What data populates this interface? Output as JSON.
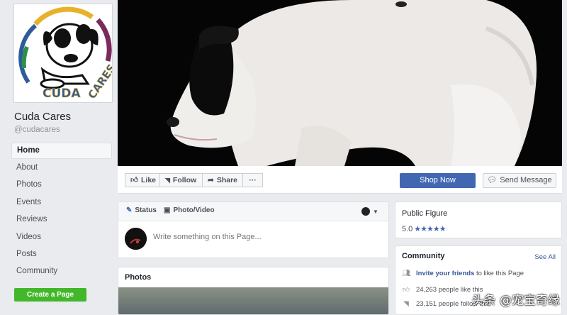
{
  "page": {
    "name": "Cuda Cares",
    "handle": "@cudacares",
    "logo_text": "CUDA CARES"
  },
  "nav": {
    "items": [
      {
        "label": "Home",
        "active": true
      },
      {
        "label": "About"
      },
      {
        "label": "Photos"
      },
      {
        "label": "Events"
      },
      {
        "label": "Reviews"
      },
      {
        "label": "Videos"
      },
      {
        "label": "Posts"
      },
      {
        "label": "Community"
      }
    ],
    "create_page": "Create a Page"
  },
  "actions": {
    "like": "Like",
    "follow": "Follow",
    "share": "Share",
    "more": "···",
    "shop_now": "Shop Now",
    "send_message": "Send Message"
  },
  "composer": {
    "status": "Status",
    "photo_video": "Photo/Video",
    "placeholder": "Write something on this Page..."
  },
  "photos": {
    "title": "Photos"
  },
  "sidebar": {
    "category": "Public Figure",
    "rating": "5.0",
    "stars": 5,
    "community_title": "Community",
    "see_all": "See All",
    "invite_link": "Invite your friends",
    "invite_rest": " to like this Page",
    "likes": "24,263 people like this",
    "follows": "23,151 people follow this"
  },
  "watermark": "头条 @宠宝奇缘",
  "colors": {
    "brand_blue": "#4267b2",
    "link_blue": "#385898",
    "green": "#42b72a",
    "background": "#e9ebee"
  }
}
